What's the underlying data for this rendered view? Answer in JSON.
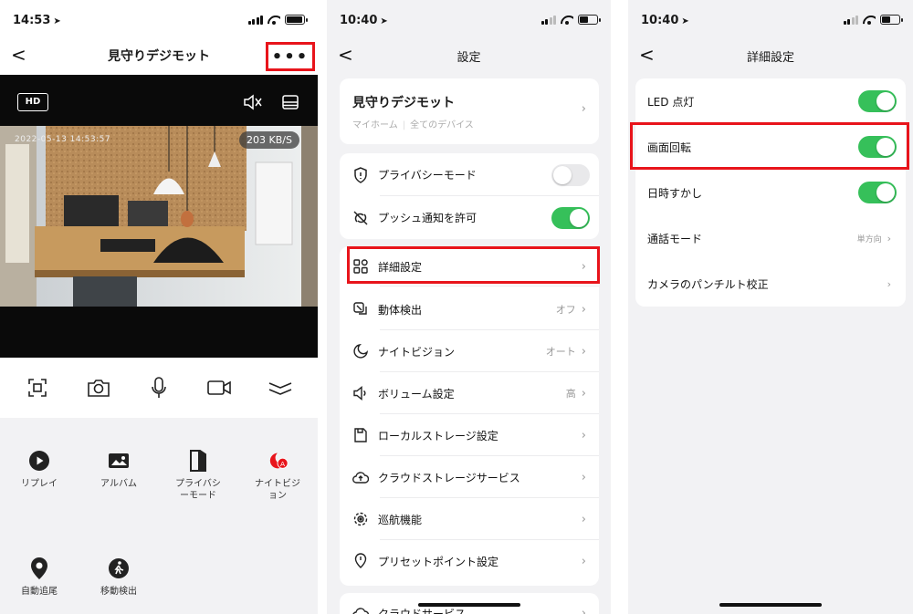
{
  "panel_home": {
    "status": {
      "time": "14:53",
      "battery_level": 0.85
    },
    "nav": {
      "back": "<",
      "title": "見守りデジモット",
      "more": "•••"
    },
    "video": {
      "hd_label": "HD",
      "timestamp": "2022-05-13  14:53:57",
      "bitrate": "203 KB/S",
      "icons": [
        "speaker-muted-icon",
        "layout-icon"
      ]
    },
    "controls": [
      "fullscreen-icon",
      "camera-icon",
      "microphone-icon",
      "video-record-icon",
      "collapse-icon"
    ],
    "features": [
      {
        "label": "リプレイ",
        "icon": "play-icon"
      },
      {
        "label": "アルバム",
        "icon": "album-icon"
      },
      {
        "label": "プライバシーモード",
        "icon": "privacy-icon"
      },
      {
        "label": "ナイトビジョン",
        "icon": "night-vision-icon"
      },
      {
        "label": "自動追尾",
        "icon": "location-pin-icon"
      },
      {
        "label": "移動検出",
        "icon": "walking-person-icon"
      }
    ]
  },
  "panel_settings": {
    "status": {
      "time": "10:40",
      "battery_level": 0.45
    },
    "nav": {
      "back": "<",
      "title": "設定"
    },
    "device": {
      "name": "見守りデジモット",
      "location": "マイホーム",
      "group": "全てのデバイス"
    },
    "toggles": [
      {
        "label": "プライバシーモード",
        "on": false,
        "icon": "privacy-shield-icon"
      },
      {
        "label": "プッシュ通知を許可",
        "on": true,
        "icon": "notification-off-icon"
      }
    ],
    "items": [
      {
        "label": "詳細設定",
        "value": "",
        "icon": "grid-icon"
      },
      {
        "label": "動体検出",
        "value": "オフ",
        "icon": "motion-detect-icon"
      },
      {
        "label": "ナイトビジョン",
        "value": "オート",
        "icon": "moon-icon"
      },
      {
        "label": "ボリューム設定",
        "value": "高",
        "icon": "volume-icon"
      },
      {
        "label": "ローカルストレージ設定",
        "value": "",
        "icon": "storage-icon"
      },
      {
        "label": "クラウドストレージサービス",
        "value": "",
        "icon": "cloud-icon"
      },
      {
        "label": "巡航機能",
        "value": "",
        "icon": "patrol-icon"
      },
      {
        "label": "プリセットポイント設定",
        "value": "",
        "icon": "preset-pin-icon"
      }
    ],
    "partial_item": "クラウドサービス"
  },
  "panel_advanced": {
    "status": {
      "time": "10:40",
      "battery_level": 0.45
    },
    "nav": {
      "back": "<",
      "title": "詳細設定"
    },
    "toggles": [
      {
        "label": "LED 点灯",
        "on": true
      },
      {
        "label": "画面回転",
        "on": true
      },
      {
        "label": "日時すかし",
        "on": true
      }
    ],
    "items": [
      {
        "label": "通話モード",
        "value": "単方向"
      },
      {
        "label": "カメラのパンチルト校正",
        "value": ""
      }
    ]
  },
  "colors": {
    "highlight": "#e8141b",
    "toggle_on": "#36c05a",
    "toggle_off": "#e9e9eb",
    "background": "#f2f2f4"
  }
}
